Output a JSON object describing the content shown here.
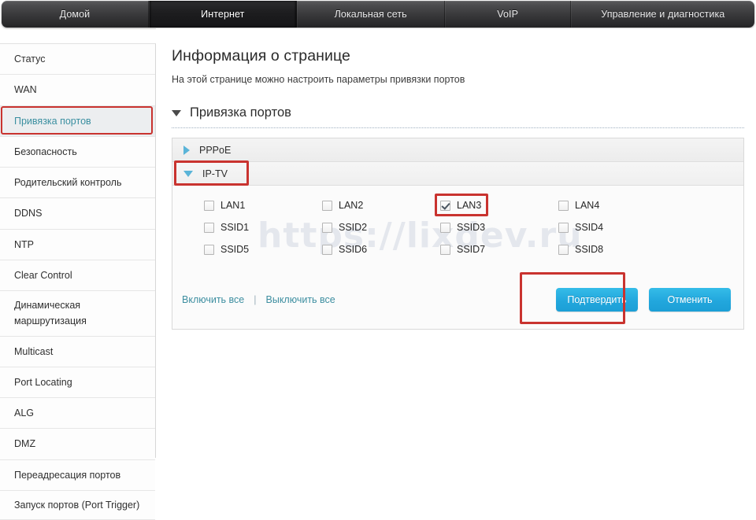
{
  "topnav": {
    "tabs": [
      {
        "label": "Домой",
        "active": false
      },
      {
        "label": "Интернет",
        "active": true
      },
      {
        "label": "Локальная сеть",
        "active": false
      },
      {
        "label": "VoIP",
        "active": false
      },
      {
        "label": "Управление и диагностика",
        "active": false
      }
    ]
  },
  "sidebar": {
    "items": [
      {
        "label": "Статус"
      },
      {
        "label": "WAN"
      },
      {
        "label": "Привязка портов"
      },
      {
        "label": "Безопасность"
      },
      {
        "label": "Родительский контроль"
      },
      {
        "label": "DDNS"
      },
      {
        "label": "NTP"
      },
      {
        "label": "Clear Control"
      },
      {
        "label": "Динамическая маршрутизация"
      },
      {
        "label": "Multicast"
      },
      {
        "label": "Port Locating"
      },
      {
        "label": "ALG"
      },
      {
        "label": "DMZ"
      },
      {
        "label": "Переадресация портов"
      },
      {
        "label": "Запуск портов (Port Trigger)"
      }
    ],
    "active_index": 2
  },
  "main": {
    "page_title": "Информация о странице",
    "page_subtitle": "На этой странице можно настроить параметры привязки портов",
    "section_title": "Привязка портов",
    "accordion": [
      {
        "label": "PPPoE",
        "expanded": false,
        "icon": "triangle-right-icon"
      },
      {
        "label": "IP-TV",
        "expanded": true,
        "icon": "triangle-down-icon"
      }
    ],
    "checkboxes": [
      {
        "label": "LAN1",
        "checked": false
      },
      {
        "label": "LAN2",
        "checked": false
      },
      {
        "label": "LAN3",
        "checked": true
      },
      {
        "label": "LAN4",
        "checked": false
      },
      {
        "label": "SSID1",
        "checked": false
      },
      {
        "label": "SSID2",
        "checked": false
      },
      {
        "label": "SSID3",
        "checked": false
      },
      {
        "label": "SSID4",
        "checked": false
      },
      {
        "label": "SSID5",
        "checked": false
      },
      {
        "label": "SSID6",
        "checked": false
      },
      {
        "label": "SSID7",
        "checked": false
      },
      {
        "label": "SSID8",
        "checked": false
      }
    ],
    "watermark": "https://lixdev.ru",
    "enable_all_label": "Включить все",
    "disable_all_label": "Выключить все",
    "link_divider": "|",
    "confirm_label": "Подтвердить",
    "cancel_label": "Отменить"
  },
  "colors": {
    "accent_blue": "#22a7dd",
    "link_teal": "#3d8ea0",
    "highlight_red": "#c9332f",
    "nav_dark": "#3a3a3c",
    "active_item_bg": "#eceef0"
  }
}
